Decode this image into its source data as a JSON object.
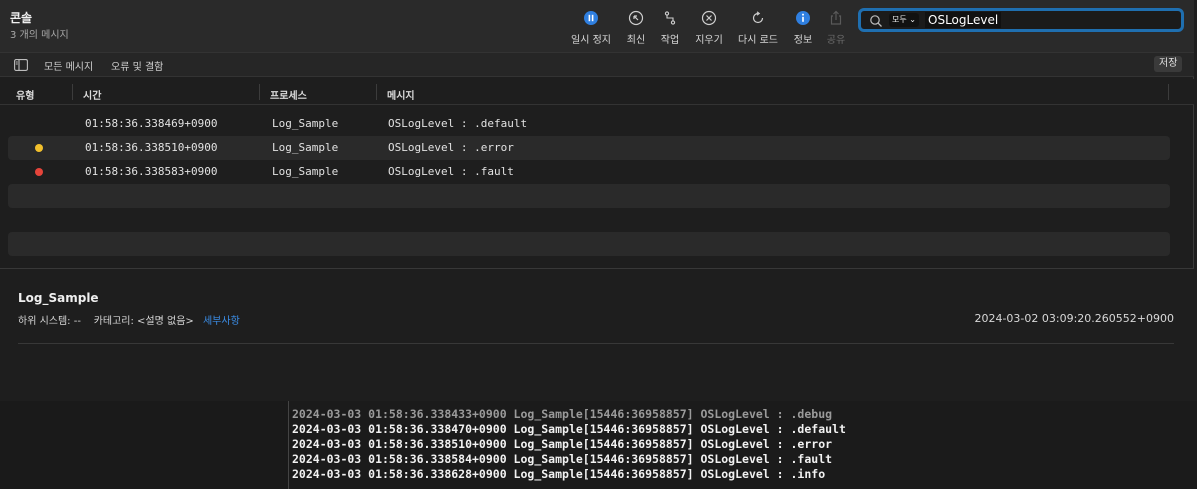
{
  "app": {
    "title": "콘솔",
    "subtitle": "3 개의 메시지"
  },
  "toolbar": {
    "buttons": [
      {
        "label": "일시 정지",
        "icon": "pause-icon",
        "active": true
      },
      {
        "label": "최신",
        "icon": "scroll-to-latest-icon"
      },
      {
        "label": "작업",
        "icon": "activities-icon"
      },
      {
        "label": "지우기",
        "icon": "clear-icon"
      },
      {
        "label": "다시 로드",
        "icon": "reload-icon"
      },
      {
        "label": "정보",
        "icon": "info-icon",
        "active": true
      },
      {
        "label": "공유",
        "icon": "share-icon",
        "disabled": true
      }
    ]
  },
  "search": {
    "scope": "모두",
    "token": "OSLogLevel"
  },
  "filters": {
    "tabs": [
      "모든 메시지",
      "오류 및 결함"
    ],
    "save_label": "저장"
  },
  "columns": [
    "유형",
    "시간",
    "프로세스",
    "메시지"
  ],
  "rows": [
    {
      "type": "default",
      "dot_color": "",
      "time": "01:58:36.338469+0900",
      "process": "Log_Sample",
      "message": "OSLogLevel : .default"
    },
    {
      "type": "error",
      "dot_color": "#f2c02c",
      "time": "01:58:36.338510+0900",
      "process": "Log_Sample",
      "message": "OSLogLevel : .error"
    },
    {
      "type": "fault",
      "dot_color": "#e5443a",
      "time": "01:58:36.338583+0900",
      "process": "Log_Sample",
      "message": "OSLogLevel : .fault"
    }
  ],
  "detail": {
    "process": "Log_Sample",
    "subsystem_label": "하위 시스템:",
    "subsystem_value": "--",
    "category_label": "카테고리:",
    "category_value": "<설명 없음>",
    "details_link": "세부사항",
    "timestamp": "2024-03-02 03:09:20.260552+0900"
  },
  "terminal": {
    "lines": [
      "2024-03-03 01:58:36.338433+0900 Log_Sample[15446:36958857] OSLogLevel : .debug",
      "2024-03-03 01:58:36.338470+0900 Log_Sample[15446:36958857] OSLogLevel : .default",
      "2024-03-03 01:58:36.338510+0900 Log_Sample[15446:36958857] OSLogLevel : .error",
      "2024-03-03 01:58:36.338584+0900 Log_Sample[15446:36958857] OSLogLevel : .fault",
      "2024-03-03 01:58:36.338628+0900 Log_Sample[15446:36958857] OSLogLevel : .info"
    ]
  },
  "colors": {
    "accent": "#1f6fb0",
    "link": "#3b8ee8",
    "active_icon": "#2f7fe0"
  }
}
